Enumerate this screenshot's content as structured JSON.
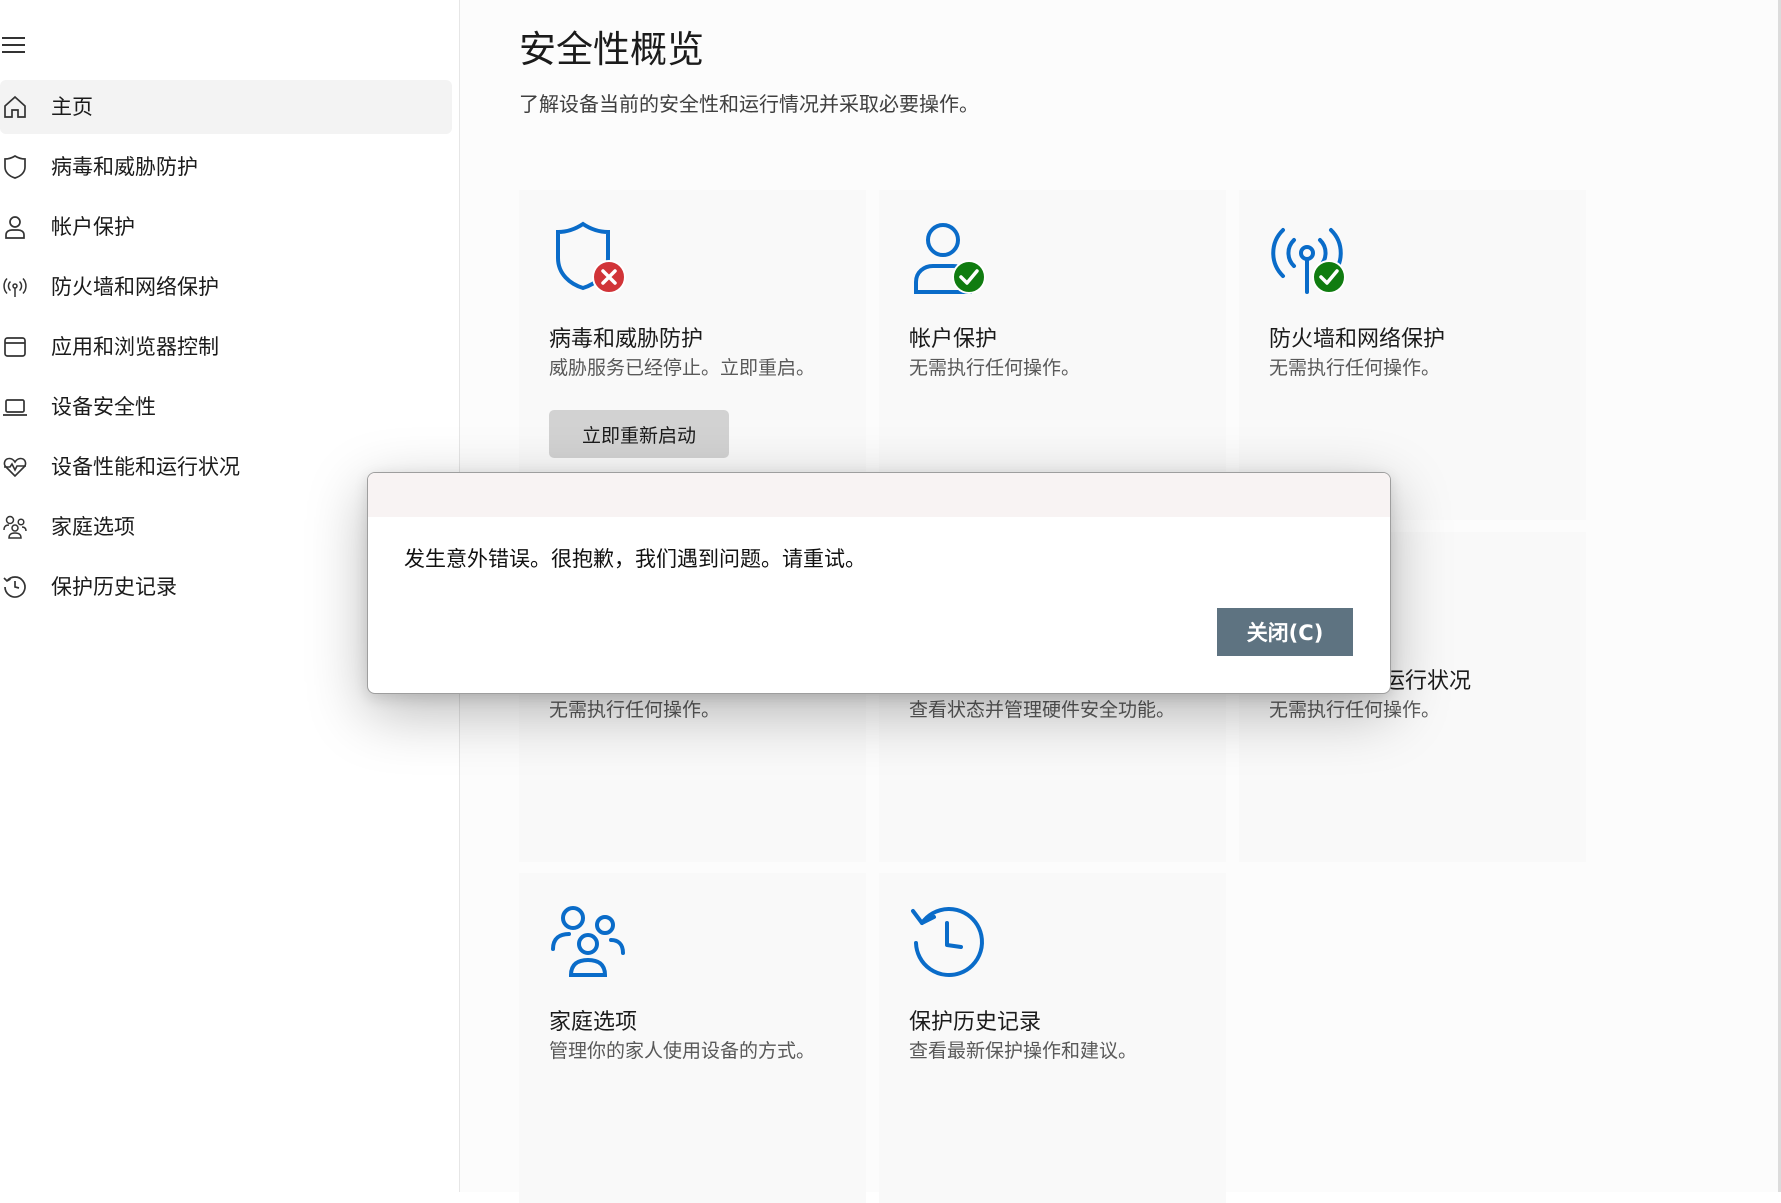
{
  "sidebar": {
    "menu_icon": "hamburger-menu-icon",
    "items": [
      {
        "label": "主页",
        "icon": "home-icon",
        "active": true
      },
      {
        "label": "病毒和威胁防护",
        "icon": "shield-icon",
        "active": false
      },
      {
        "label": "帐户保护",
        "icon": "person-icon",
        "active": false
      },
      {
        "label": "防火墙和网络保护",
        "icon": "antenna-icon",
        "active": false
      },
      {
        "label": "应用和浏览器控制",
        "icon": "browser-window-icon",
        "active": false
      },
      {
        "label": "设备安全性",
        "icon": "laptop-icon",
        "active": false
      },
      {
        "label": "设备性能和运行状况",
        "icon": "heart-pulse-icon",
        "active": false
      },
      {
        "label": "家庭选项",
        "icon": "family-icon",
        "active": false
      },
      {
        "label": "保护历史记录",
        "icon": "history-icon",
        "active": false
      }
    ]
  },
  "main": {
    "title": "安全性概览",
    "subtitle": "了解设备当前的安全性和运行情况并采取必要操作。",
    "cards": [
      {
        "title": "病毒和威胁防护",
        "desc": "威胁服务已经停止。立即重启。",
        "icon": "shield-error-icon",
        "status": "error",
        "button": "立即重新启动"
      },
      {
        "title": "帐户保护",
        "desc": "无需执行任何操作。",
        "icon": "account-ok-icon",
        "status": "ok"
      },
      {
        "title": "防火墙和网络保护",
        "desc": "无需执行任何操作。",
        "icon": "antenna-ok-icon",
        "status": "ok"
      },
      {
        "title": "",
        "desc": "无需执行任何操作。"
      },
      {
        "title": "",
        "desc": "查看状态并管理硬件安全功能。"
      },
      {
        "title": "运行状况",
        "desc": "无需执行任何操作。"
      },
      {
        "title": "家庭选项",
        "desc": "管理你的家人使用设备的方式。",
        "icon": "family-icon"
      },
      {
        "title": "保护历史记录",
        "desc": "查看最新保护操作和建议。",
        "icon": "history-icon"
      }
    ]
  },
  "dialog": {
    "message": "发生意外错误。很抱歉，我们遇到问题。请重试。",
    "close_label": "关闭(C)"
  },
  "colors": {
    "accent_blue": "#0a6cc9",
    "error_red": "#d13438",
    "ok_green": "#107c10",
    "dialog_button": "#5e7381"
  }
}
